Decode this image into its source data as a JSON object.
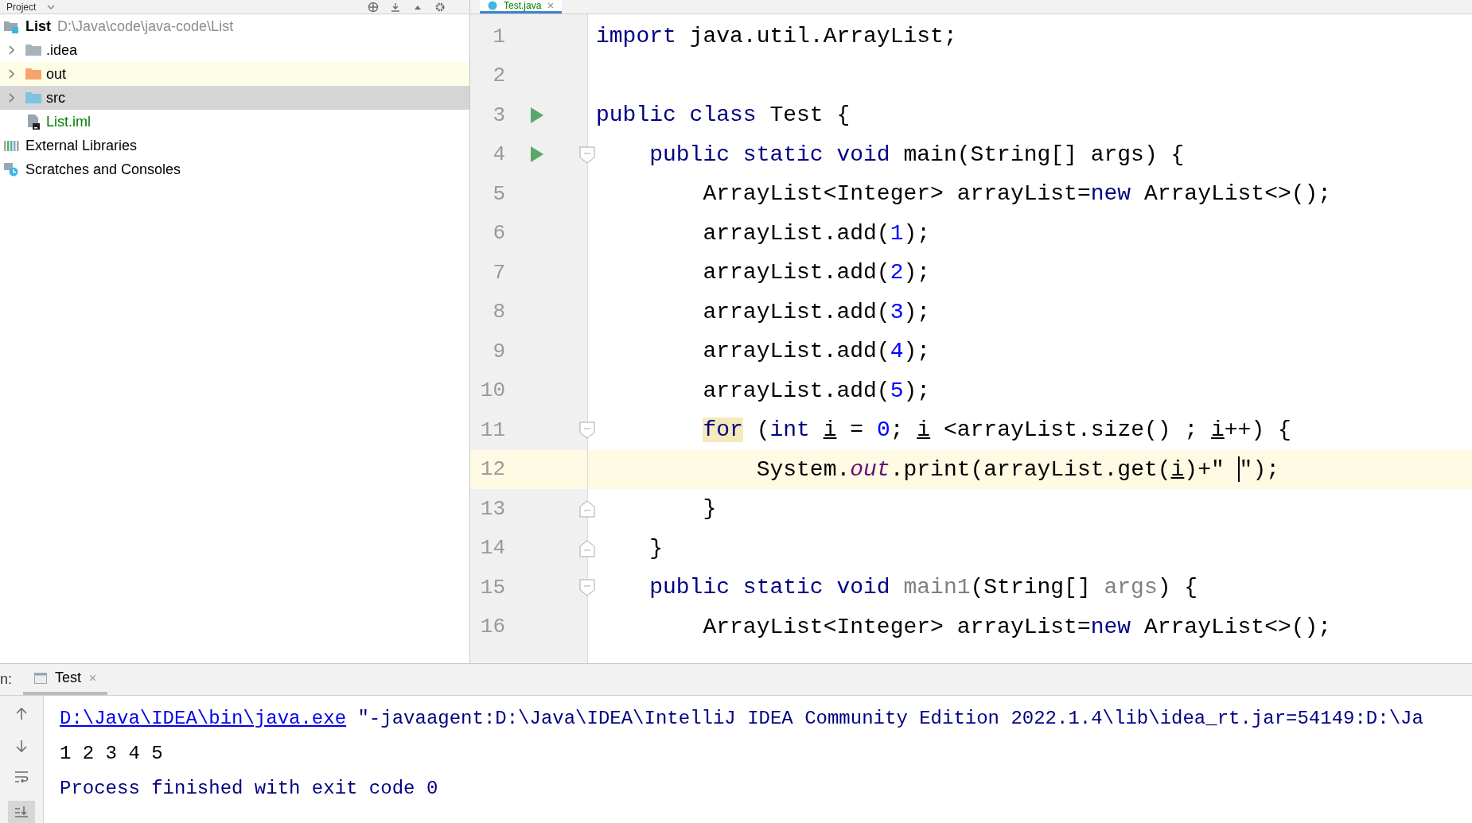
{
  "project": {
    "title": "Project",
    "tree": [
      {
        "kind": "module",
        "label": "List",
        "path": "D:\\Java\\code\\java-code\\List",
        "selected": false,
        "children": [
          {
            "kind": "folder",
            "label": ".idea",
            "color": "#aab2b9",
            "expanded": false,
            "excluded": false,
            "selected": false
          },
          {
            "kind": "folder",
            "label": "out",
            "color": "#f4a46c",
            "expanded": false,
            "excluded": true,
            "selected": false
          },
          {
            "kind": "folder",
            "label": "src",
            "color": "#7ec3e0",
            "expanded": false,
            "excluded": false,
            "selected": true
          },
          {
            "kind": "module-file",
            "label": "List.iml",
            "selected": false
          }
        ]
      },
      {
        "kind": "libraries",
        "label": "External Libraries",
        "selected": false
      },
      {
        "kind": "scratches",
        "label": "Scratches and Consoles",
        "selected": false
      }
    ]
  },
  "editor": {
    "tabs": [
      {
        "label": "Test.java",
        "selected": true
      }
    ],
    "lines": [
      {
        "number": "1",
        "current": false,
        "run_marker": false,
        "tokens": [
          {
            "kind": "keyword",
            "text": "import"
          },
          {
            "kind": "plain",
            "text": " java.util.ArrayList;"
          }
        ]
      },
      {
        "number": "2",
        "current": false,
        "run_marker": false
      },
      {
        "number": "3",
        "current": false,
        "run_marker": true,
        "tokens": [
          {
            "kind": "keyword",
            "text": "public class"
          },
          {
            "kind": "plain",
            "text": " Test {"
          }
        ]
      },
      {
        "number": "4",
        "current": false,
        "run_marker": true,
        "fold_start": true,
        "tokens": [
          {
            "kind": "keyword",
            "text": "    public static void"
          },
          {
            "kind": "plain",
            "text": " main(String[] args) {"
          }
        ]
      },
      {
        "number": "5",
        "current": false,
        "run_marker": false,
        "tokens": [
          {
            "kind": "plain",
            "text": "        ArrayList<Integer> arrayList="
          },
          {
            "kind": "keyword",
            "text": "new"
          },
          {
            "kind": "plain",
            "text": " ArrayList<>();"
          }
        ]
      },
      {
        "number": "6",
        "current": false,
        "run_marker": false,
        "tokens": [
          {
            "kind": "plain",
            "text": "        arrayList.add("
          },
          {
            "kind": "number",
            "text": "1"
          },
          {
            "kind": "plain",
            "text": ");"
          }
        ]
      },
      {
        "number": "7",
        "current": false,
        "run_marker": false,
        "tokens": [
          {
            "kind": "plain",
            "text": "        arrayList.add("
          },
          {
            "kind": "number",
            "text": "2"
          },
          {
            "kind": "plain",
            "text": ");"
          }
        ]
      },
      {
        "number": "8",
        "current": false,
        "run_marker": false,
        "tokens": [
          {
            "kind": "plain",
            "text": "        arrayList.add("
          },
          {
            "kind": "number",
            "text": "3"
          },
          {
            "kind": "plain",
            "text": ");"
          }
        ]
      },
      {
        "number": "9",
        "current": false,
        "run_marker": false,
        "tokens": [
          {
            "kind": "plain",
            "text": "        arrayList.add("
          },
          {
            "kind": "number",
            "text": "4"
          },
          {
            "kind": "plain",
            "text": ");"
          }
        ]
      },
      {
        "number": "10",
        "current": false,
        "run_marker": false,
        "tokens": [
          {
            "kind": "plain",
            "text": "        arrayList.add("
          },
          {
            "kind": "number",
            "text": "5"
          },
          {
            "kind": "plain",
            "text": ");"
          }
        ]
      },
      {
        "number": "11",
        "current": false,
        "run_marker": false,
        "fold_start": true,
        "tokens": [
          {
            "kind": "keyword-match",
            "text": "        for"
          },
          {
            "kind": "plain",
            "text": " ("
          },
          {
            "kind": "keyword",
            "text": "int "
          },
          {
            "kind": "variable",
            "text": "i"
          },
          {
            "kind": "plain",
            "text": " = "
          },
          {
            "kind": "number",
            "text": "0"
          },
          {
            "kind": "plain",
            "text": "; "
          },
          {
            "kind": "variable",
            "text": "i"
          },
          {
            "kind": "plain",
            "text": " <arrayList.size() ; "
          },
          {
            "kind": "variable",
            "text": "i"
          },
          {
            "kind": "plain",
            "text": "++) {"
          }
        ]
      },
      {
        "number": "12",
        "current": true,
        "run_marker": false,
        "tokens": [
          {
            "kind": "plain",
            "text": "            System."
          },
          {
            "kind": "field",
            "text": "out"
          },
          {
            "kind": "plain",
            "text": ".print(arrayList.get("
          },
          {
            "kind": "variable",
            "text": "i"
          },
          {
            "kind": "plain",
            "text": ")+\" "
          },
          {
            "kind": "caret"
          },
          {
            "kind": "plain",
            "text": "\");"
          }
        ]
      },
      {
        "number": "13",
        "current": false,
        "run_marker": false,
        "fold_end": true,
        "tokens": [
          {
            "kind": "plain",
            "text": "        }"
          }
        ]
      },
      {
        "number": "14",
        "current": false,
        "run_marker": false,
        "fold_end": true,
        "tokens": [
          {
            "kind": "plain",
            "text": "    }"
          }
        ]
      },
      {
        "number": "15",
        "current": false,
        "run_marker": false,
        "fold_start": true,
        "tokens": [
          {
            "kind": "keyword",
            "text": "    public static void "
          },
          {
            "kind": "unused",
            "text": "main1"
          },
          {
            "kind": "plain",
            "text": "(String[] "
          },
          {
            "kind": "unused",
            "text": "args"
          },
          {
            "kind": "plain",
            "text": ") {"
          }
        ]
      },
      {
        "number": "16",
        "current": false,
        "run_marker": false,
        "tokens": [
          {
            "kind": "plain",
            "text": "        ArrayList<Integer> arrayList="
          },
          {
            "kind": "keyword",
            "text": "new"
          },
          {
            "kind": "plain",
            "text": " ArrayList<>();"
          }
        ]
      }
    ]
  },
  "run_panel": {
    "label": "n:",
    "tabs": [
      {
        "label": "Test",
        "selected": true
      }
    ],
    "console": [
      {
        "kind": "command",
        "link": "D:\\Java\\IDEA\\bin\\java.exe",
        "text": " \"-javaagent:D:\\Java\\IDEA\\IntelliJ IDEA Community Edition 2022.1.4\\lib\\idea_rt.jar=54149:D:\\Ja"
      },
      {
        "kind": "output",
        "text": "1 2 3 4 5"
      },
      {
        "kind": "system",
        "text": "Process finished with exit code 0"
      }
    ]
  }
}
